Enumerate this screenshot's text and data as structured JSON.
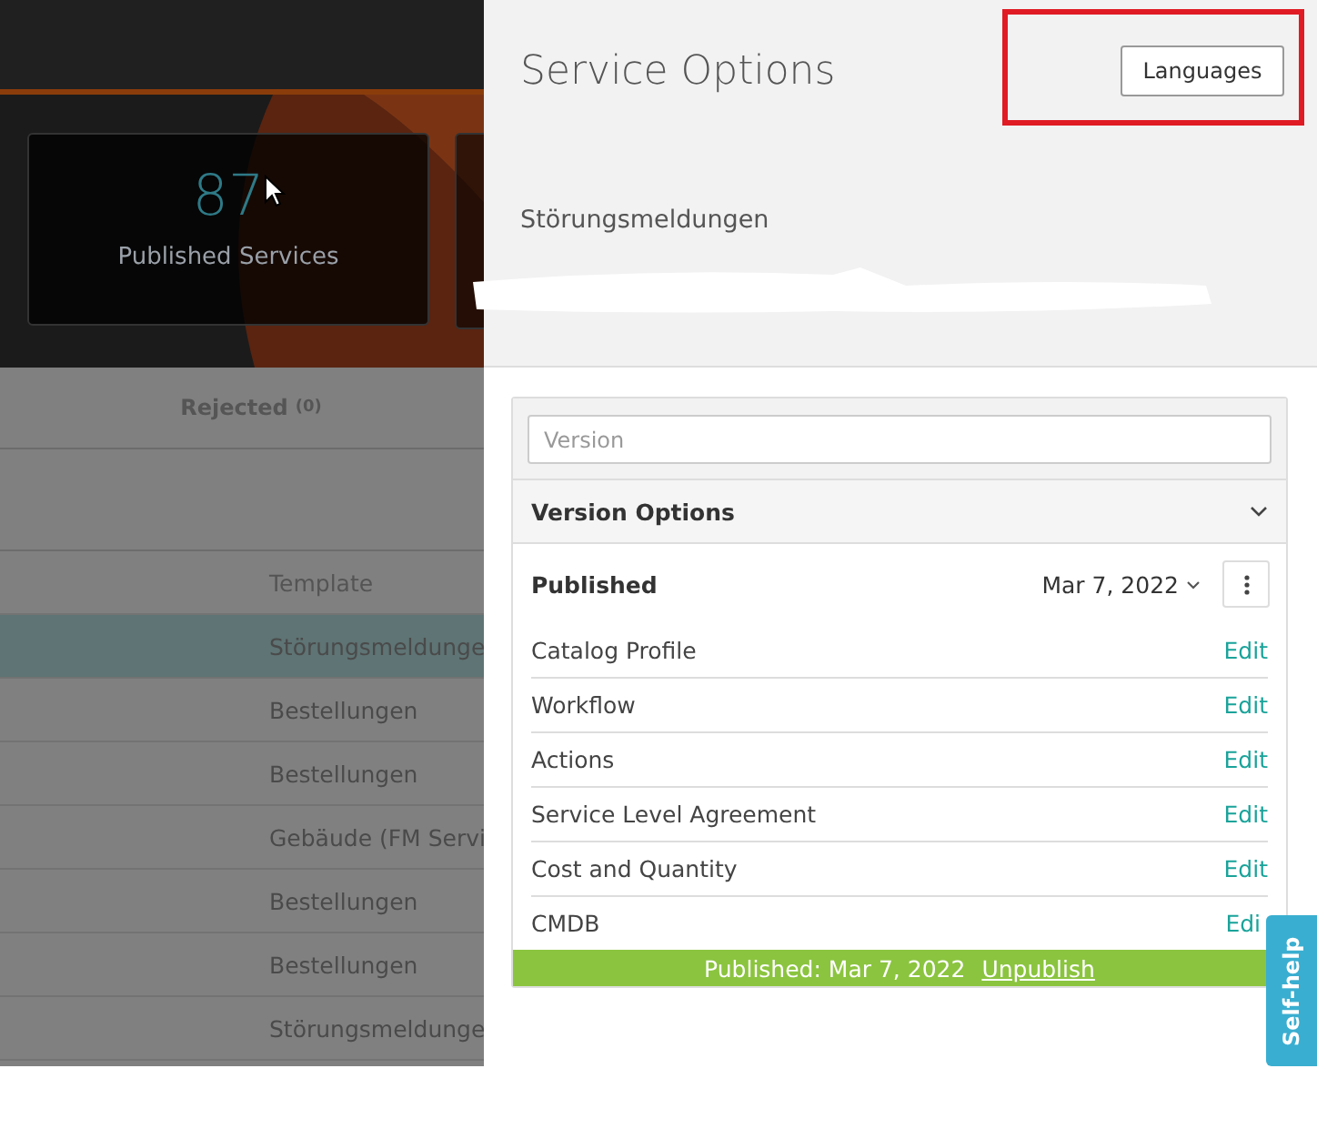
{
  "dashboard": {
    "stat": {
      "value": "87",
      "label": "Published Services"
    },
    "tabs": [
      {
        "label": "Rejected",
        "count": "(0)",
        "selected": false
      }
    ],
    "table": {
      "columns": [
        "Template"
      ],
      "rows": [
        {
          "template": "Störungsmeldunge",
          "selected": true
        },
        {
          "template": "Bestellungen",
          "selected": false
        },
        {
          "template": "Bestellungen",
          "selected": false
        },
        {
          "template": "Gebäude (FM Servi",
          "selected": false
        },
        {
          "template": "Bestellungen",
          "selected": false
        },
        {
          "template": "Bestellungen",
          "selected": false
        },
        {
          "template": "Störungsmeldunge",
          "selected": false
        }
      ]
    }
  },
  "panel": {
    "title": "Service Options",
    "languages_button": "Languages",
    "subtitle": "Störungsmeldungen",
    "version_field": {
      "placeholder": "Version"
    },
    "section": {
      "title": "Version Options",
      "expanded": true
    },
    "version": {
      "status": "Published",
      "date": "Mar 7, 2022"
    },
    "options": [
      {
        "name": "Catalog Profile",
        "action": "Edit"
      },
      {
        "name": "Workflow",
        "action": "Edit"
      },
      {
        "name": "Actions",
        "action": "Edit"
      },
      {
        "name": "Service Level Agreement",
        "action": "Edit"
      },
      {
        "name": "Cost and Quantity",
        "action": "Edit"
      },
      {
        "name": "CMDB",
        "action": "Edi"
      }
    ],
    "footer": {
      "text": "Published: Mar 7, 2022",
      "link": "Unpublish"
    }
  },
  "self_help": "Self-help"
}
